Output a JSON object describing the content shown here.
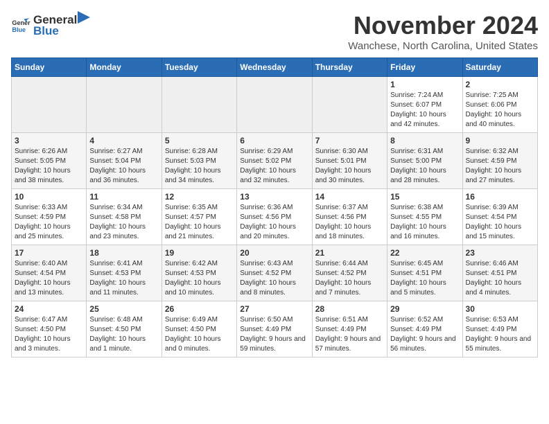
{
  "logo": {
    "general": "General",
    "blue": "Blue"
  },
  "title": "November 2024",
  "subtitle": "Wanchese, North Carolina, United States",
  "weekdays": [
    "Sunday",
    "Monday",
    "Tuesday",
    "Wednesday",
    "Thursday",
    "Friday",
    "Saturday"
  ],
  "weeks": [
    [
      {
        "day": "",
        "info": ""
      },
      {
        "day": "",
        "info": ""
      },
      {
        "day": "",
        "info": ""
      },
      {
        "day": "",
        "info": ""
      },
      {
        "day": "",
        "info": ""
      },
      {
        "day": "1",
        "info": "Sunrise: 7:24 AM\nSunset: 6:07 PM\nDaylight: 10 hours and 42 minutes."
      },
      {
        "day": "2",
        "info": "Sunrise: 7:25 AM\nSunset: 6:06 PM\nDaylight: 10 hours and 40 minutes."
      }
    ],
    [
      {
        "day": "3",
        "info": "Sunrise: 6:26 AM\nSunset: 5:05 PM\nDaylight: 10 hours and 38 minutes."
      },
      {
        "day": "4",
        "info": "Sunrise: 6:27 AM\nSunset: 5:04 PM\nDaylight: 10 hours and 36 minutes."
      },
      {
        "day": "5",
        "info": "Sunrise: 6:28 AM\nSunset: 5:03 PM\nDaylight: 10 hours and 34 minutes."
      },
      {
        "day": "6",
        "info": "Sunrise: 6:29 AM\nSunset: 5:02 PM\nDaylight: 10 hours and 32 minutes."
      },
      {
        "day": "7",
        "info": "Sunrise: 6:30 AM\nSunset: 5:01 PM\nDaylight: 10 hours and 30 minutes."
      },
      {
        "day": "8",
        "info": "Sunrise: 6:31 AM\nSunset: 5:00 PM\nDaylight: 10 hours and 28 minutes."
      },
      {
        "day": "9",
        "info": "Sunrise: 6:32 AM\nSunset: 4:59 PM\nDaylight: 10 hours and 27 minutes."
      }
    ],
    [
      {
        "day": "10",
        "info": "Sunrise: 6:33 AM\nSunset: 4:59 PM\nDaylight: 10 hours and 25 minutes."
      },
      {
        "day": "11",
        "info": "Sunrise: 6:34 AM\nSunset: 4:58 PM\nDaylight: 10 hours and 23 minutes."
      },
      {
        "day": "12",
        "info": "Sunrise: 6:35 AM\nSunset: 4:57 PM\nDaylight: 10 hours and 21 minutes."
      },
      {
        "day": "13",
        "info": "Sunrise: 6:36 AM\nSunset: 4:56 PM\nDaylight: 10 hours and 20 minutes."
      },
      {
        "day": "14",
        "info": "Sunrise: 6:37 AM\nSunset: 4:56 PM\nDaylight: 10 hours and 18 minutes."
      },
      {
        "day": "15",
        "info": "Sunrise: 6:38 AM\nSunset: 4:55 PM\nDaylight: 10 hours and 16 minutes."
      },
      {
        "day": "16",
        "info": "Sunrise: 6:39 AM\nSunset: 4:54 PM\nDaylight: 10 hours and 15 minutes."
      }
    ],
    [
      {
        "day": "17",
        "info": "Sunrise: 6:40 AM\nSunset: 4:54 PM\nDaylight: 10 hours and 13 minutes."
      },
      {
        "day": "18",
        "info": "Sunrise: 6:41 AM\nSunset: 4:53 PM\nDaylight: 10 hours and 11 minutes."
      },
      {
        "day": "19",
        "info": "Sunrise: 6:42 AM\nSunset: 4:53 PM\nDaylight: 10 hours and 10 minutes."
      },
      {
        "day": "20",
        "info": "Sunrise: 6:43 AM\nSunset: 4:52 PM\nDaylight: 10 hours and 8 minutes."
      },
      {
        "day": "21",
        "info": "Sunrise: 6:44 AM\nSunset: 4:52 PM\nDaylight: 10 hours and 7 minutes."
      },
      {
        "day": "22",
        "info": "Sunrise: 6:45 AM\nSunset: 4:51 PM\nDaylight: 10 hours and 5 minutes."
      },
      {
        "day": "23",
        "info": "Sunrise: 6:46 AM\nSunset: 4:51 PM\nDaylight: 10 hours and 4 minutes."
      }
    ],
    [
      {
        "day": "24",
        "info": "Sunrise: 6:47 AM\nSunset: 4:50 PM\nDaylight: 10 hours and 3 minutes."
      },
      {
        "day": "25",
        "info": "Sunrise: 6:48 AM\nSunset: 4:50 PM\nDaylight: 10 hours and 1 minute."
      },
      {
        "day": "26",
        "info": "Sunrise: 6:49 AM\nSunset: 4:50 PM\nDaylight: 10 hours and 0 minutes."
      },
      {
        "day": "27",
        "info": "Sunrise: 6:50 AM\nSunset: 4:49 PM\nDaylight: 9 hours and 59 minutes."
      },
      {
        "day": "28",
        "info": "Sunrise: 6:51 AM\nSunset: 4:49 PM\nDaylight: 9 hours and 57 minutes."
      },
      {
        "day": "29",
        "info": "Sunrise: 6:52 AM\nSunset: 4:49 PM\nDaylight: 9 hours and 56 minutes."
      },
      {
        "day": "30",
        "info": "Sunrise: 6:53 AM\nSunset: 4:49 PM\nDaylight: 9 hours and 55 minutes."
      }
    ]
  ]
}
